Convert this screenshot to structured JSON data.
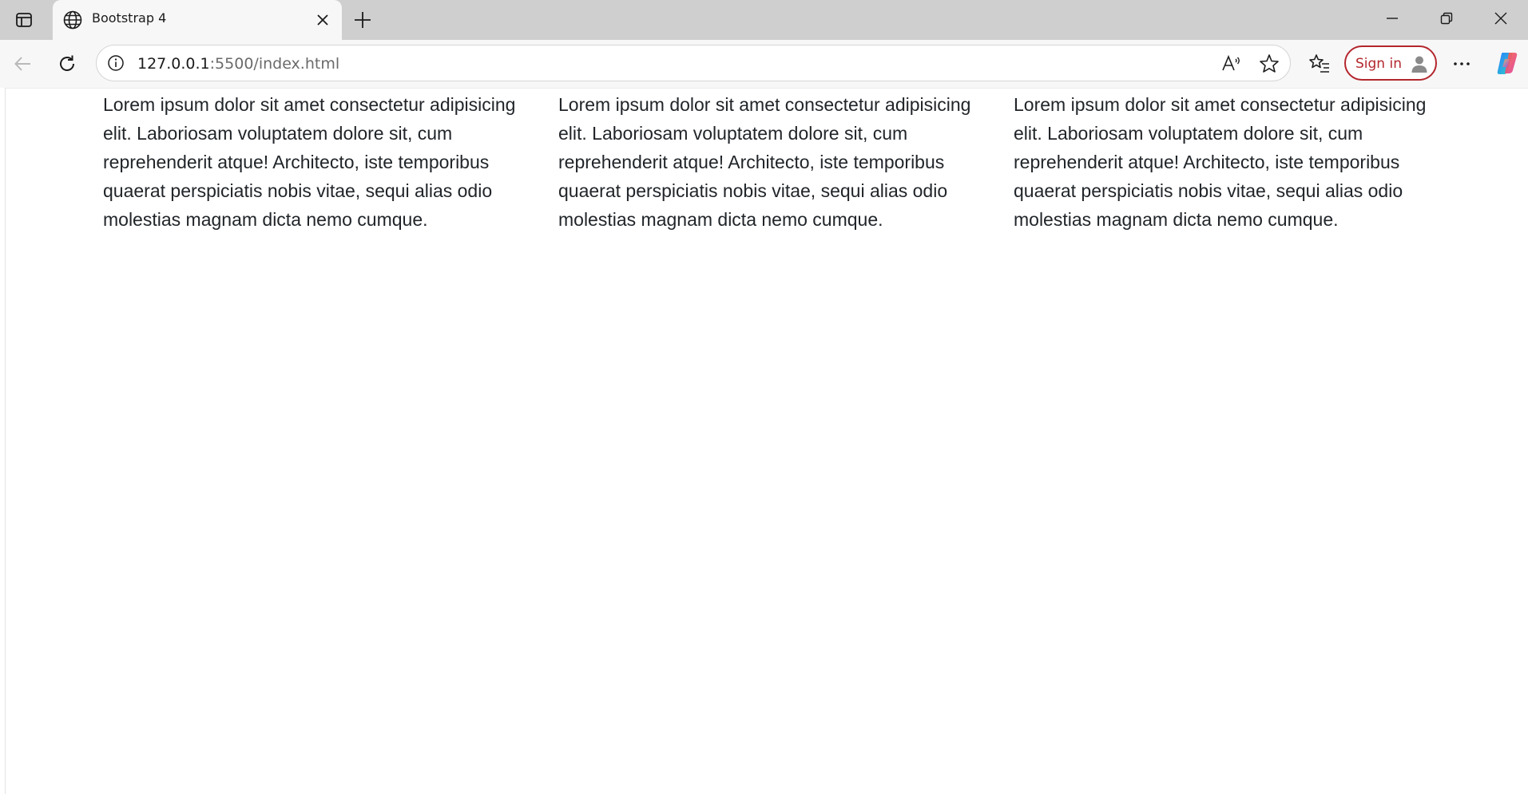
{
  "tab": {
    "title": "Bootstrap 4"
  },
  "address_bar": {
    "url_host": "127.0.0.1",
    "url_rest": ":5500/index.html"
  },
  "profile": {
    "sign_in_label": "Sign in"
  },
  "icons": {
    "tab_actions": "tab-actions-icon",
    "favicon": "globe-icon",
    "tab_close": "close-icon",
    "new_tab": "plus-icon",
    "minimize": "minimize-icon",
    "restore": "restore-icon",
    "close_window": "close-icon",
    "back": "back-arrow-icon",
    "refresh": "refresh-icon",
    "site_info": "info-icon",
    "read_aloud": "read-aloud-icon",
    "favorite": "star-icon",
    "favorites_list": "favorites-icon",
    "avatar": "person-icon",
    "more": "more-icon",
    "copilot": "copilot-icon"
  },
  "colors": {
    "tabstrip_bg": "#cfcfcf",
    "toolbar_bg": "#f7f7f7",
    "sign_in_accent": "#b3262d",
    "body_text": "#212529"
  },
  "page": {
    "columns": [
      {
        "text": "Lorem ipsum dolor sit amet consectetur adipisicing elit. Laboriosam voluptatem dolore sit, cum reprehenderit atque! Architecto, iste temporibus quaerat perspiciatis nobis vitae, sequi alias odio molestias magnam dicta nemo cumque."
      },
      {
        "text": "Lorem ipsum dolor sit amet consectetur adipisicing elit. Laboriosam voluptatem dolore sit, cum reprehenderit atque! Architecto, iste temporibus quaerat perspiciatis nobis vitae, sequi alias odio molestias magnam dicta nemo cumque."
      },
      {
        "text": "Lorem ipsum dolor sit amet consectetur adipisicing elit. Laboriosam voluptatem dolore sit, cum reprehenderit atque! Architecto, iste temporibus quaerat perspiciatis nobis vitae, sequi alias odio molestias magnam dicta nemo cumque."
      }
    ]
  }
}
